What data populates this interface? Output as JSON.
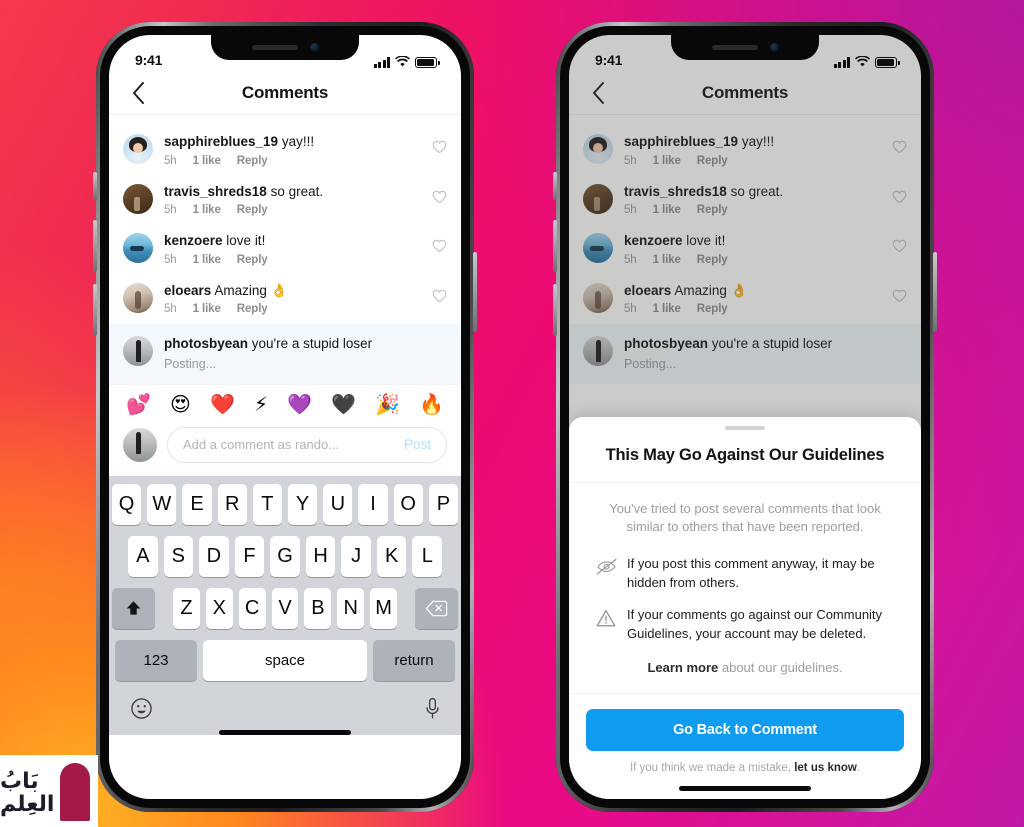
{
  "background": {
    "gradient_colors": [
      "#f43b4a",
      "#ed1164",
      "#e80a85",
      "#c018a6",
      "#ff8a1e",
      "#ffb225"
    ]
  },
  "watermark": {
    "line1": "بَابُ",
    "line2": "العِلم",
    "shape_color": "#a31a46"
  },
  "status_bar": {
    "time": "9:41",
    "signal_icon": "cellular-bars-icon",
    "wifi_icon": "wifi-icon",
    "battery_icon": "battery-icon"
  },
  "header": {
    "title": "Comments",
    "back_icon": "chevron-left-icon"
  },
  "comments": [
    {
      "username": "sapphireblues_19",
      "text": "yay!!!",
      "time": "5h",
      "likes": "1 like",
      "reply": "Reply",
      "avatar": "av1",
      "heart_icon": "heart-outline-icon"
    },
    {
      "username": "travis_shreds18",
      "text": "so great.",
      "time": "5h",
      "likes": "1 like",
      "reply": "Reply",
      "avatar": "av2",
      "heart_icon": "heart-outline-icon"
    },
    {
      "username": "kenzoere",
      "text": "love it!",
      "time": "5h",
      "likes": "1 like",
      "reply": "Reply",
      "avatar": "av3",
      "heart_icon": "heart-outline-icon"
    },
    {
      "username": "eloears",
      "text": "Amazing 👌",
      "time": "5h",
      "likes": "1 like",
      "reply": "Reply",
      "avatar": "av4",
      "heart_icon": "heart-outline-icon"
    }
  ],
  "pending_comment": {
    "username": "photosbyean",
    "text": "you're a stupid loser",
    "status": "Posting...",
    "avatar": "av5"
  },
  "emoji_bar": [
    "💕",
    "😍",
    "❤️",
    "⚡",
    "💜",
    "🖤",
    "🎉",
    "🔥"
  ],
  "composer": {
    "placeholder": "Add a comment as rando...",
    "post_label": "Post",
    "avatar": "av5"
  },
  "keyboard": {
    "row1": [
      "Q",
      "W",
      "E",
      "R",
      "T",
      "Y",
      "U",
      "I",
      "O",
      "P"
    ],
    "row2": [
      "A",
      "S",
      "D",
      "F",
      "G",
      "H",
      "J",
      "K",
      "L"
    ],
    "row3": [
      "Z",
      "X",
      "C",
      "V",
      "B",
      "N",
      "M"
    ],
    "shift_icon": "shift-up-arrow-icon",
    "backspace_icon": "backspace-delete-icon",
    "numbers_label": "123",
    "space_label": "space",
    "return_label": "return",
    "emoji_icon": "smiley-face-icon",
    "mic_icon": "microphone-icon"
  },
  "modal": {
    "handle": "drag-handle",
    "title": "This May Go Against Our Guidelines",
    "subtitle": "You've tried to post several comments that look similar to others that have been reported.",
    "bullets": [
      {
        "icon": "eye-slash-icon",
        "text": "If you post this comment anyway, it may be hidden from others."
      },
      {
        "icon": "warning-triangle-icon",
        "text": "If your comments go against our Community Guidelines, your account may be deleted."
      }
    ],
    "learn_more_link": "Learn more",
    "learn_more_rest": " about our guidelines.",
    "cta_label": "Go Back to Comment",
    "cta_color": "#0f9bf0",
    "footer_prefix": "If you think we made a mistake, ",
    "footer_link": "let us know",
    "footer_suffix": "."
  }
}
